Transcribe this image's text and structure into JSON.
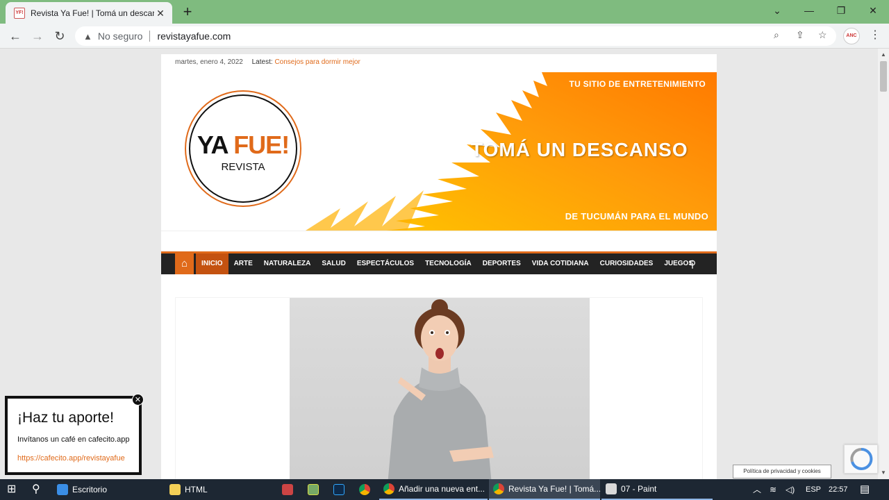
{
  "browser": {
    "tab_title": "Revista Ya Fue! | Tomá un descanso",
    "tab_favicon": "YF!",
    "new_tab": "+",
    "security_label": "No seguro",
    "url": "revistayafue.com",
    "profile_label": "ANC",
    "window_controls": {
      "dropdown": "⌄",
      "minimize": "—",
      "restore": "❐",
      "close": "✕"
    }
  },
  "site": {
    "date": "martes, enero 4, 2022",
    "latest_label": "Latest:",
    "latest_link": "Consejos para dormir mejor",
    "logo": {
      "ya": "YA ",
      "fue": "FUE!",
      "revista": "REVISTA"
    },
    "banner": {
      "top": "TU SITIO DE ENTRETENIMIENTO",
      "main": "TOMÁ UN DESCANSO",
      "bottom": "DE TUCUMÁN PARA EL MUNDO"
    },
    "nav": {
      "items": [
        "INICIO",
        "ARTE",
        "NATURALEZA",
        "SALUD",
        "ESPECTÁCULOS",
        "TECNOLOGÍA",
        "DEPORTES",
        "VIDA COTIDIANA",
        "CURIOSIDADES",
        "JUEGOS"
      ],
      "active": "INICIO"
    }
  },
  "popup": {
    "title": "¡Haz tu aporte!",
    "subtitle": "Invítanos un café en cafecito.app",
    "link": "https://cafecito.app/revistayafue"
  },
  "cookies_label": "Política de privacidad y cookies",
  "taskbar": {
    "desktop": "Escritorio",
    "html_folder": "HTML",
    "chrome_1": "Añadir una nueva ent...",
    "chrome_2": "Revista Ya Fue! | Tomá...",
    "paint": "07 - Paint",
    "lang": "ESP",
    "time": "22:57"
  },
  "colors": {
    "accent": "#e06a1a",
    "nav_bg": "#232323",
    "taskbar": "#1d2733",
    "tabbar": "#7fbb7f"
  }
}
